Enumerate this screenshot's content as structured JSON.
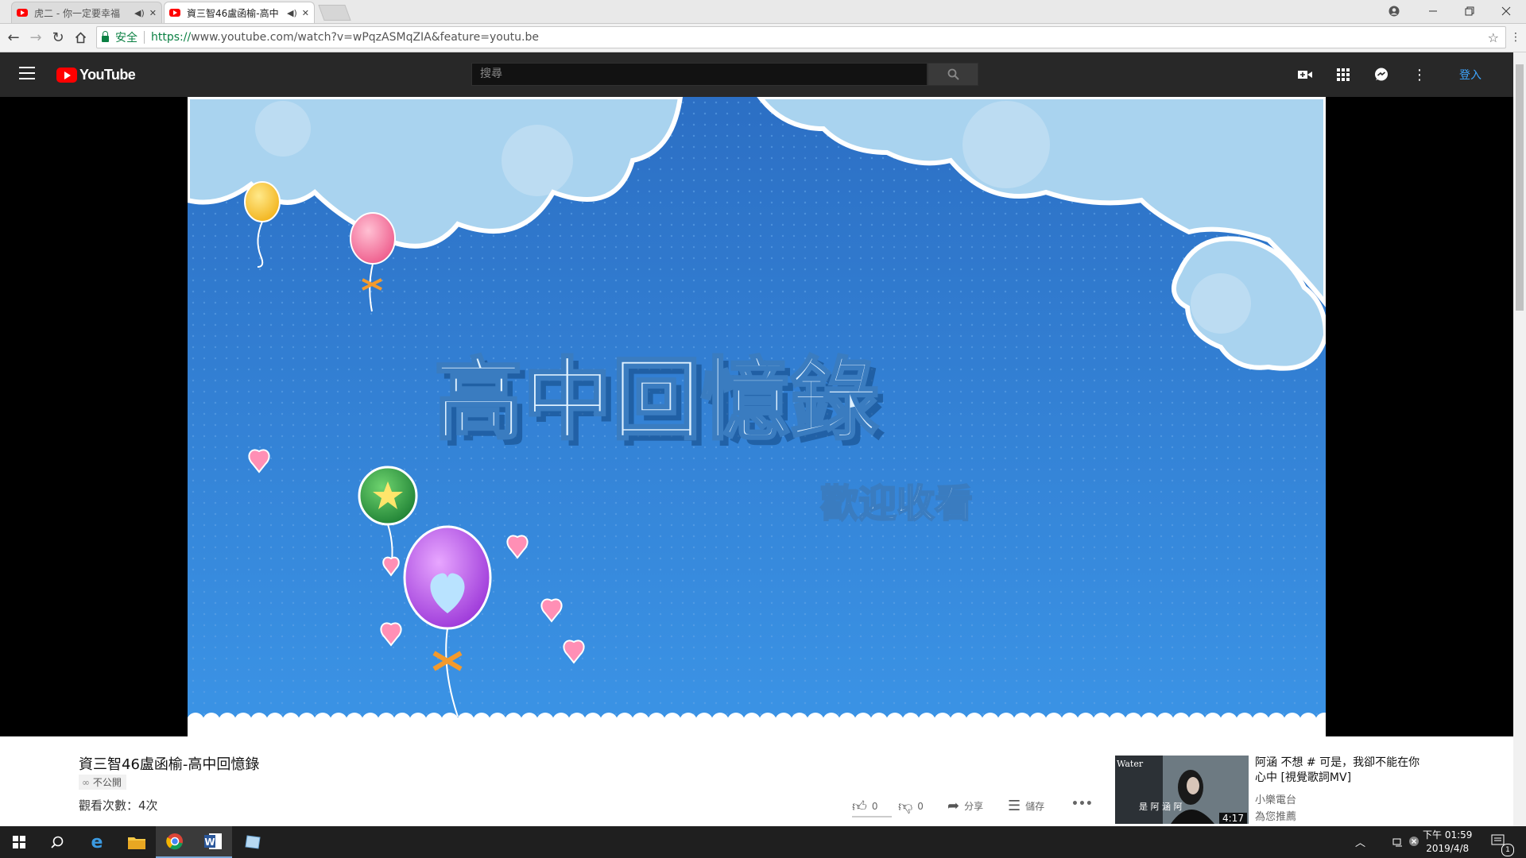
{
  "browser": {
    "tabs": [
      {
        "title": "虎二 - 你一定要幸福",
        "active": false
      },
      {
        "title": "資三智46盧函榆-高中",
        "active": true
      }
    ],
    "secure_label": "安全",
    "url_proto": "https://",
    "url_rest": "www.youtube.com/watch?v=wPqzASMqZIA&feature=youtu.be"
  },
  "youtube": {
    "logo_text": "YouTube",
    "search_placeholder": "搜尋",
    "signin_label": "登入"
  },
  "video_frame": {
    "heading": "高中回憶錄",
    "subheading": "歡迎收看"
  },
  "video": {
    "title": "資三智46盧函榆-高中回憶錄",
    "privacy": "不公開",
    "views": "觀看次數：4次",
    "like_count": "0",
    "dislike_count": "0",
    "share_label": "分享",
    "save_label": "儲存",
    "more_label": "•••"
  },
  "recommendation": {
    "title": "阿涵 不想 # 可是，我卻不能在你心中 [視覺歌詞MV]",
    "channel": "小樂電台",
    "note": "為您推薦",
    "duration": "4:17",
    "thumb_text": "Water",
    "thumb_caption": "是 阿 涵 阿"
  },
  "taskbar": {
    "clock_time": "下午 01:59",
    "clock_date": "2019/4/8",
    "notification_count": "1"
  },
  "colors": {
    "masthead": "#282828",
    "youtube_red": "#ff0000",
    "link_blue": "#3ea6ff",
    "sky_blue": "#2f7cd6"
  }
}
